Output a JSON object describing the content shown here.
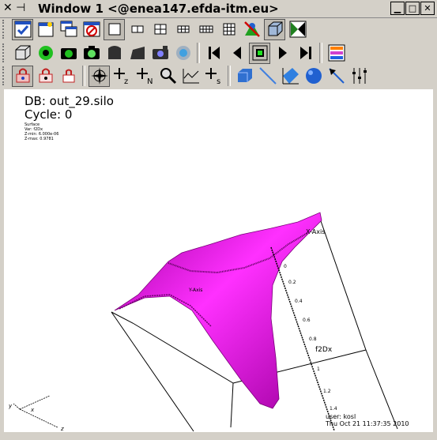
{
  "window": {
    "title": "Window 1 <@enea147.efda-itm.eu>",
    "bg": "#d4d0c8"
  },
  "toolbars": {
    "row1": [
      "active-window-icon",
      "new-window-icon",
      "copy-window-icon",
      "clear-window-icon",
      "layout-1x1-icon",
      "layout-1x2-icon",
      "layout-2x2-icon",
      "layout-2x3-icon",
      "layout-3x3-icon",
      "lock-time-icon",
      "lock-view-icon",
      "spin-mode-icon"
    ],
    "row2": [
      "reset-view-icon",
      "undo-view-icon",
      "redo-view-icon",
      "save-image-icon",
      "recenter-icon",
      "undo-op-icon",
      "print-icon",
      "invert-icon",
      "reverse-step-icon",
      "play-reverse-icon",
      "stop-icon",
      "play-icon",
      "forward-step-icon",
      "palette-icon"
    ],
    "row3": [
      "lock-all-icon",
      "lock-tool-icon",
      "lock-icon",
      "navigate-icon",
      "zoom-z-icon",
      "add-n-icon",
      "zoom-icon",
      "lineout-icon",
      "add-s-icon",
      "box-tool-icon",
      "line-tool-icon",
      "plane-tool-icon",
      "sphere-tool-icon",
      "point-tool-icon",
      "extents-tool-icon"
    ]
  },
  "viewport": {
    "db_label": "DB: out_29.silo",
    "cycle_label": "Cycle: 0",
    "legend": {
      "plot": "Surface",
      "var": "Var: f2Dx",
      "zmin": "Z-min:   6.000e-06",
      "zmax": "Z-max:   0.9781"
    },
    "axes": {
      "y_axis_title": "Y-Axis",
      "x_axis_title": "X-Axis",
      "z_axis_title": "f2Dx",
      "z_ticks": [
        "0",
        "0.2",
        "0.4",
        "0.6",
        "0.8",
        "1",
        "1.2",
        "1.4"
      ],
      "triad": {
        "x": "x",
        "y": "y",
        "z": "z"
      }
    },
    "footer": {
      "user": "user: kosl",
      "date": "Thu Oct 21 11:37:35 2010"
    },
    "surface_color": "#cc00cc"
  }
}
